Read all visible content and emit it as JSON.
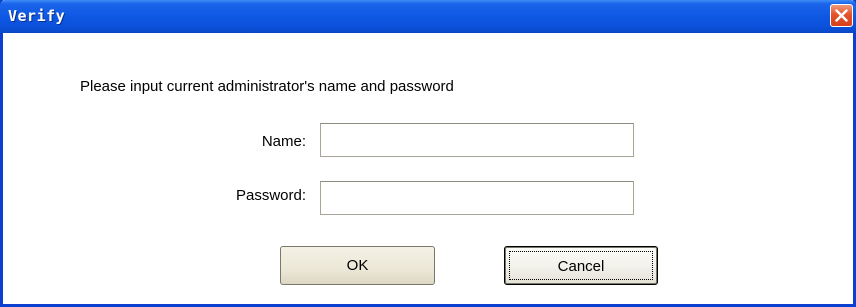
{
  "window": {
    "title": "Verify"
  },
  "dialog": {
    "prompt": "Please input current administrator's name and password",
    "name_label": "Name:",
    "name_value": "",
    "password_label": "Password:",
    "password_value": "",
    "ok_label": "OK",
    "cancel_label": "Cancel"
  },
  "icons": {
    "close": "close-icon"
  },
  "colors": {
    "titlebar": "#0f58e4",
    "close_button": "#e2532c",
    "frame": "#0a3fd0"
  }
}
